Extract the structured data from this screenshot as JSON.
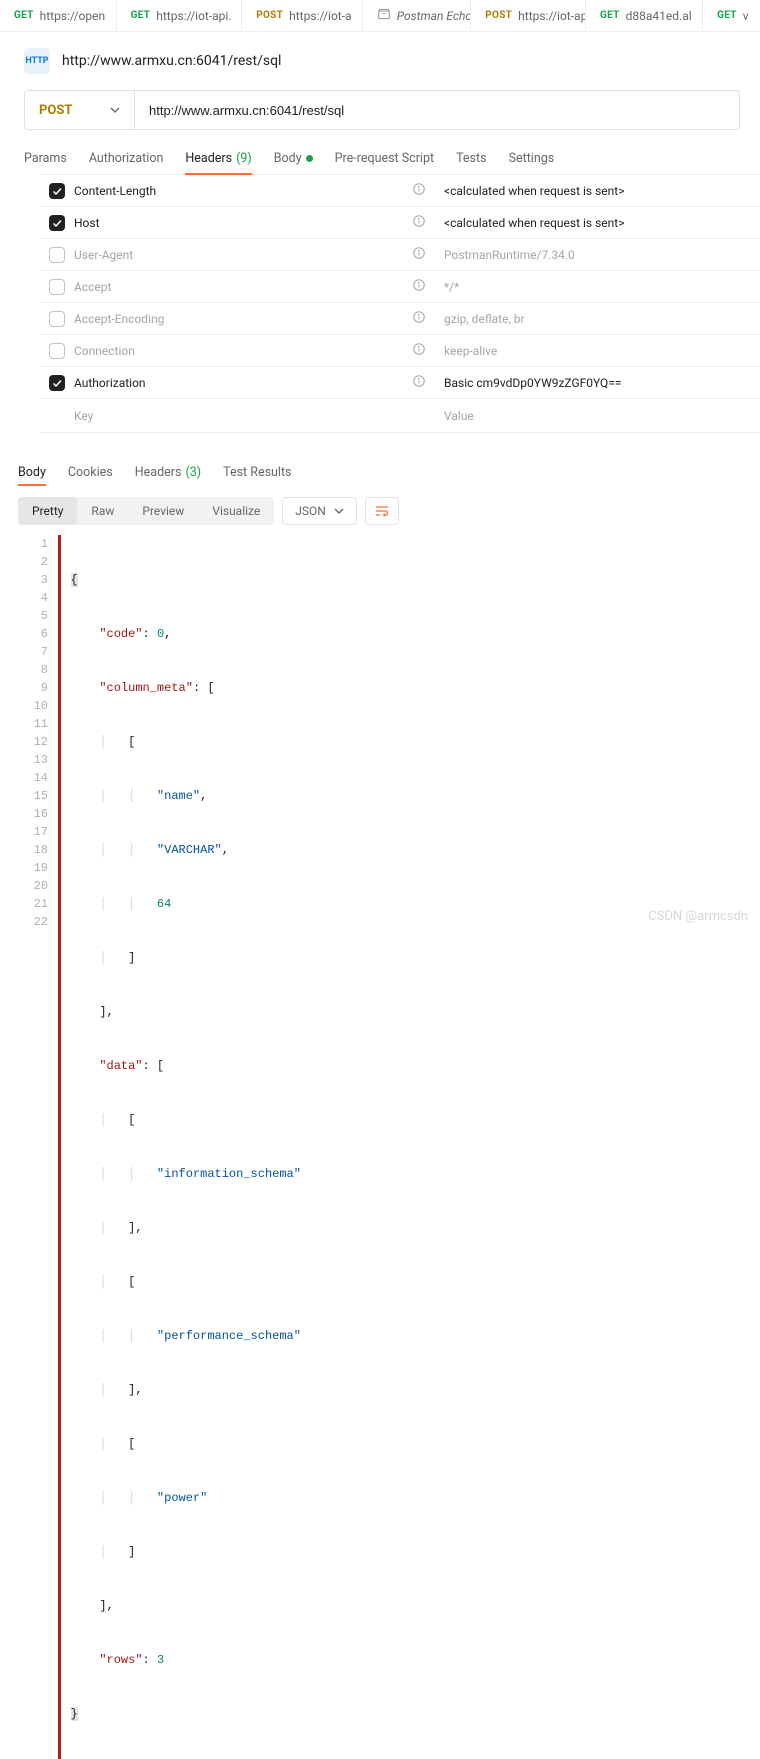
{
  "tabs": [
    {
      "method": "GET",
      "mclass": "m-get",
      "title": "https://open",
      "dot": true
    },
    {
      "method": "GET",
      "mclass": "m-get",
      "title": "https://iot-api.",
      "dot": true
    },
    {
      "method": "POST",
      "mclass": "m-post",
      "title": "https://iot-a",
      "dot": true
    },
    {
      "method": "",
      "mclass": "",
      "title": "Postman Echo",
      "dot": false,
      "crate": true
    },
    {
      "method": "POST",
      "mclass": "m-post",
      "title": "https://iot-ap",
      "dot": false
    },
    {
      "method": "GET",
      "mclass": "m-get",
      "title": "d88a41ed.al",
      "dot": true
    },
    {
      "method": "GET",
      "mclass": "m-get",
      "title": "v",
      "dot": false
    }
  ],
  "request": {
    "badge": "HTTP",
    "title": "http://www.armxu.cn:6041/rest/sql",
    "method": "POST",
    "url": "http://www.armxu.cn:6041/rest/sql"
  },
  "req_tabs": {
    "params": "Params",
    "auth": "Authorization",
    "headers": "Headers",
    "headers_count": "(9)",
    "body": "Body",
    "prereq": "Pre-request Script",
    "tests": "Tests",
    "settings": "Settings"
  },
  "headers": [
    {
      "checked": true,
      "key": "Content-Length",
      "val": "<calculated when request is sent>"
    },
    {
      "checked": true,
      "key": "Host",
      "val": "<calculated when request is sent>"
    },
    {
      "checked": false,
      "key": "User-Agent",
      "val": "PostmanRuntime/7.34.0"
    },
    {
      "checked": false,
      "key": "Accept",
      "val": "*/*"
    },
    {
      "checked": false,
      "key": "Accept-Encoding",
      "val": "gzip, deflate, br"
    },
    {
      "checked": false,
      "key": "Connection",
      "val": "keep-alive"
    },
    {
      "checked": true,
      "key": "Authorization",
      "val": "Basic cm9vdDp0YW9zZGF0YQ=="
    }
  ],
  "headers_input": {
    "key": "Key",
    "value": "Value"
  },
  "resp_tabs": {
    "body": "Body",
    "cookies": "Cookies",
    "headers": "Headers",
    "headers_count": "(3)",
    "test_results": "Test Results"
  },
  "resp_toolbar": {
    "pretty": "Pretty",
    "raw": "Raw",
    "preview": "Preview",
    "visualize": "Visualize",
    "format": "JSON"
  },
  "code": {
    "line1a": "\"code\"",
    "line1b": "0",
    "line2a": "\"column_meta\"",
    "line5a": "\"name\"",
    "line6a": "\"VARCHAR\"",
    "line7a": "64",
    "line10a": "\"data\"",
    "line12a": "\"information_schema\"",
    "line15a": "\"performance_schema\"",
    "line18a": "\"power\"",
    "line21a": "\"rows\"",
    "line21b": "3"
  },
  "watermark": "CSDN @armcsdn"
}
